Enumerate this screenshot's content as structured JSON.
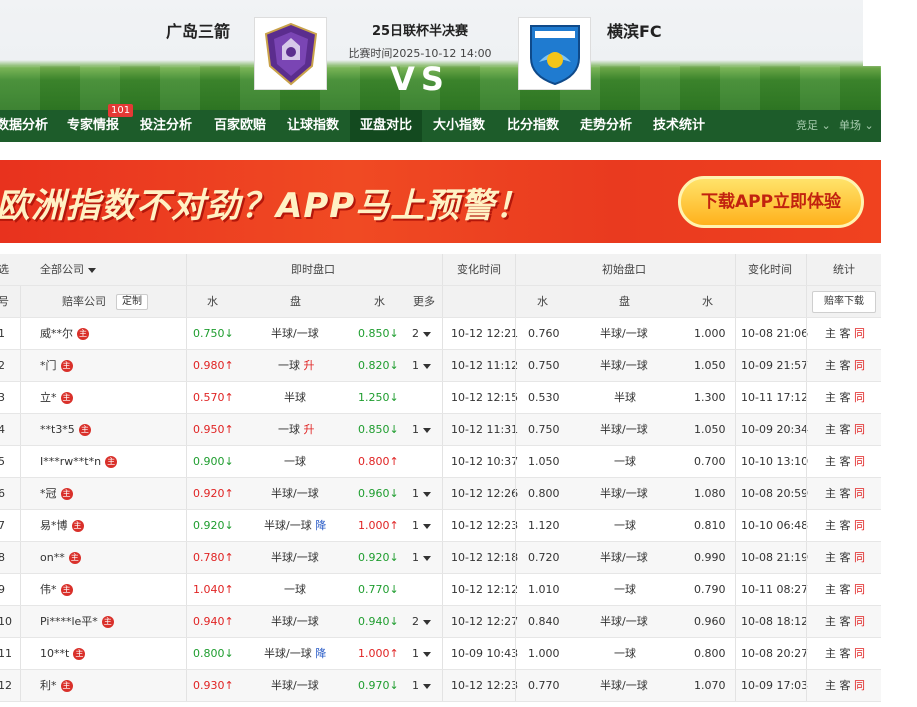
{
  "match": {
    "home_team": "广岛三箭",
    "away_team": "横滨FC",
    "title": "25日联杯半决赛",
    "time": "比赛时间2025-10-12 14:00",
    "vs": "VS"
  },
  "nav": {
    "items": [
      "数据分析",
      "专家情报",
      "投注分析",
      "百家欧赔",
      "让球指数",
      "亚盘对比",
      "大小指数",
      "比分指数",
      "走势分析",
      "技术统计"
    ],
    "badge": "101",
    "right_items": [
      "竞足",
      "单场"
    ]
  },
  "banner": {
    "text": "欧洲指数不对劲？APP马上预警！",
    "button": "下载APP立即体验"
  },
  "table": {
    "head1": {
      "col0": "选",
      "company_filter": "全部公司",
      "live": "即时盘口",
      "change_time": "变化时间",
      "initial": "初始盘口",
      "change_time2": "变化时间",
      "stats": "统计"
    },
    "head2": {
      "col0": "号",
      "company": "赔率公司",
      "custom": "定制",
      "water": "水",
      "handicap": "盘",
      "water2": "水",
      "more": "更多",
      "i_water": "水",
      "i_handicap": "盘",
      "i_water2": "水",
      "download": "赔率下载"
    },
    "rz_label": "主",
    "stat_home": "主",
    "stat_away": "客",
    "stat_same": "同",
    "rows": [
      {
        "no": "1",
        "company": "威**尔",
        "w1": "0.750↓",
        "w1dir": "down",
        "pan": "半球/一球",
        "pan_mark": "",
        "pan_dir": "",
        "w2": "0.850↓",
        "w2dir": "down",
        "more": "2",
        "time": "10-12 12:21",
        "iw1": "0.760",
        "ipan": "半球/一球",
        "iw2": "1.000",
        "itime": "10-08 21:06"
      },
      {
        "no": "2",
        "company": "*门",
        "w1": "0.980↑",
        "w1dir": "up",
        "pan": "一球",
        "pan_mark": "升",
        "pan_dir": "up",
        "w2": "0.820↓",
        "w2dir": "down",
        "more": "1",
        "time": "10-12 11:12",
        "iw1": "0.750",
        "ipan": "半球/一球",
        "iw2": "1.050",
        "itime": "10-09 21:57"
      },
      {
        "no": "3",
        "company": "立*",
        "w1": "0.570↑",
        "w1dir": "up",
        "pan": "半球",
        "pan_mark": "",
        "pan_dir": "",
        "w2": "1.250↓",
        "w2dir": "down",
        "more": "",
        "time": "10-12 12:15",
        "iw1": "0.530",
        "ipan": "半球",
        "iw2": "1.300",
        "itime": "10-11 17:12"
      },
      {
        "no": "4",
        "company": "**t3*5",
        "w1": "0.950↑",
        "w1dir": "up",
        "pan": "一球",
        "pan_mark": "升",
        "pan_dir": "up",
        "w2": "0.850↓",
        "w2dir": "down",
        "more": "1",
        "time": "10-12 11:31",
        "iw1": "0.750",
        "ipan": "半球/一球",
        "iw2": "1.050",
        "itime": "10-09 20:34"
      },
      {
        "no": "5",
        "company": "I***rw**t*n",
        "w1": "0.900↓",
        "w1dir": "down",
        "pan": "一球",
        "pan_mark": "",
        "pan_dir": "",
        "w2": "0.800↑",
        "w2dir": "up",
        "more": "",
        "time": "10-12 10:37",
        "iw1": "1.050",
        "ipan": "一球",
        "iw2": "0.700",
        "itime": "10-10 13:10"
      },
      {
        "no": "6",
        "company": "*冠",
        "w1": "0.920↑",
        "w1dir": "up",
        "pan": "半球/一球",
        "pan_mark": "",
        "pan_dir": "",
        "w2": "0.960↓",
        "w2dir": "down",
        "more": "1",
        "time": "10-12 12:26",
        "iw1": "0.800",
        "ipan": "半球/一球",
        "iw2": "1.080",
        "itime": "10-08 20:59"
      },
      {
        "no": "7",
        "company": "易*博",
        "w1": "0.920↓",
        "w1dir": "down",
        "pan": "半球/一球",
        "pan_mark": "降",
        "pan_dir": "down",
        "w2": "1.000↑",
        "w2dir": "up",
        "more": "1",
        "time": "10-12 12:23",
        "iw1": "1.120",
        "ipan": "一球",
        "iw2": "0.810",
        "itime": "10-10 06:48"
      },
      {
        "no": "8",
        "company": "on**",
        "w1": "0.780↑",
        "w1dir": "up",
        "pan": "半球/一球",
        "pan_mark": "",
        "pan_dir": "",
        "w2": "0.920↓",
        "w2dir": "down",
        "more": "1",
        "time": "10-12 12:18",
        "iw1": "0.720",
        "ipan": "半球/一球",
        "iw2": "0.990",
        "itime": "10-08 21:19"
      },
      {
        "no": "9",
        "company": "伟*",
        "w1": "1.040↑",
        "w1dir": "up",
        "pan": "一球",
        "pan_mark": "",
        "pan_dir": "",
        "w2": "0.770↓",
        "w2dir": "down",
        "more": "",
        "time": "10-12 12:12",
        "iw1": "1.010",
        "ipan": "一球",
        "iw2": "0.790",
        "itime": "10-11 08:27"
      },
      {
        "no": "10",
        "company": "Pi****le平*",
        "w1": "0.940↑",
        "w1dir": "up",
        "pan": "半球/一球",
        "pan_mark": "",
        "pan_dir": "",
        "w2": "0.940↓",
        "w2dir": "down",
        "more": "2",
        "time": "10-12 12:27",
        "iw1": "0.840",
        "ipan": "半球/一球",
        "iw2": "0.960",
        "itime": "10-08 18:12"
      },
      {
        "no": "11",
        "company": "10**t",
        "w1": "0.800↓",
        "w1dir": "down",
        "pan": "半球/一球",
        "pan_mark": "降",
        "pan_dir": "down",
        "w2": "1.000↑",
        "w2dir": "up",
        "more": "1",
        "time": "10-09 10:43",
        "iw1": "1.000",
        "ipan": "一球",
        "iw2": "0.800",
        "itime": "10-08 20:27"
      },
      {
        "no": "12",
        "company": "利*",
        "w1": "0.930↑",
        "w1dir": "up",
        "pan": "半球/一球",
        "pan_mark": "",
        "pan_dir": "",
        "w2": "0.970↓",
        "w2dir": "down",
        "more": "1",
        "time": "10-12 12:23",
        "iw1": "0.770",
        "ipan": "半球/一球",
        "iw2": "1.070",
        "itime": "10-09 17:03"
      }
    ]
  },
  "colors": {
    "nav_bg": "#1d5c2a",
    "up": "#e02424",
    "down": "#1f9d2f",
    "banner": "#ee4422"
  }
}
